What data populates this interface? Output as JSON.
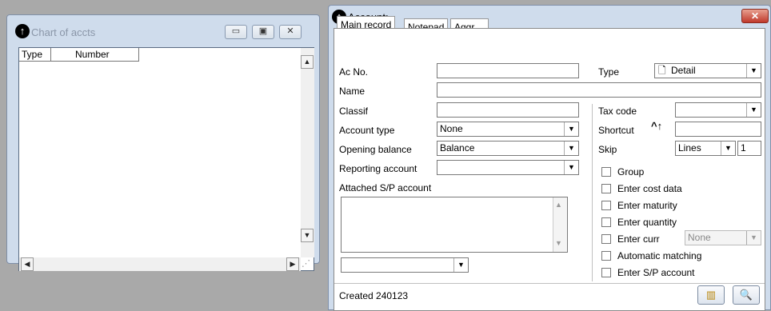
{
  "chart_window": {
    "title": "Chart of accts",
    "columns": [
      "Type",
      "Number"
    ],
    "buttons": {
      "minimize": "▭",
      "restore": "▣",
      "close": "✕"
    }
  },
  "account_window": {
    "title": "Account:",
    "tabs": [
      "Main record",
      "Notepad",
      "Aggr"
    ],
    "active_tab": "Main record",
    "fields": {
      "ac_no": {
        "label": "Ac No.",
        "value": ""
      },
      "type": {
        "label": "Type",
        "value": "Detail"
      },
      "name": {
        "label": "Name",
        "value": ""
      },
      "classif": {
        "label": "Classif",
        "value": ""
      },
      "tax_code": {
        "label": "Tax code",
        "value": ""
      },
      "account_type": {
        "label": "Account type",
        "value": "None"
      },
      "shortcut": {
        "label": "Shortcut",
        "value": ""
      },
      "opening_balance": {
        "label": "Opening balance",
        "value": "Balance"
      },
      "skip": {
        "label": "Skip",
        "value": "Lines",
        "count": "1"
      },
      "reporting_account": {
        "label": "Reporting account",
        "value": ""
      },
      "attached_sp": {
        "label": "Attached S/P account",
        "value": ""
      }
    },
    "checkboxes": [
      {
        "label": "Group",
        "checked": false
      },
      {
        "label": "Enter cost data",
        "checked": false
      },
      {
        "label": "Enter maturity",
        "checked": false
      },
      {
        "label": "Enter quantity",
        "checked": false
      },
      {
        "label": "Enter curr",
        "checked": false
      },
      {
        "label": "Automatic matching",
        "checked": false
      },
      {
        "label": "Enter S/P account",
        "checked": false
      }
    ],
    "enter_curr_select": "None",
    "status": "Created 240123",
    "icons": [
      "chart-report-icon",
      "document-search-icon"
    ]
  }
}
